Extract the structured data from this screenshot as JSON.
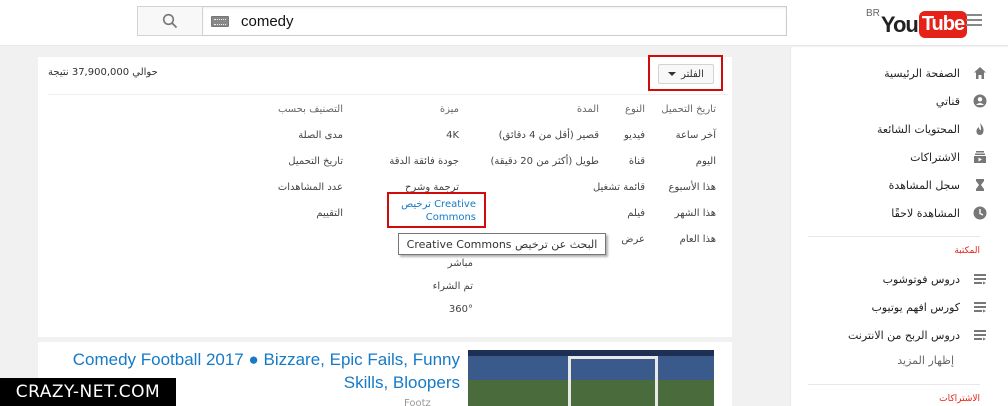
{
  "masthead": {
    "search_query": "comedy",
    "logo_region": "BR",
    "logo_you": "You",
    "logo_tube": "Tube"
  },
  "results": {
    "count_text": "حوالي 37,900,000 نتيجة",
    "filter_label": "الفلتر"
  },
  "filters": {
    "upload": {
      "head": "تاريخ التحميل",
      "items": [
        "آخر ساعة",
        "اليوم",
        "هذا الأسبوع",
        "هذا الشهر",
        "هذا العام"
      ]
    },
    "type": {
      "head": "النوع",
      "items": [
        "فيديو",
        "قناة",
        "قائمة تشغيل",
        "فيلم",
        "عرض"
      ]
    },
    "duration": {
      "head": "المدة",
      "items": [
        "قصير (أقل من 4 دقائق)",
        "طويل (أكثر من 20 دقيقة)"
      ]
    },
    "features": {
      "head": "ميزة",
      "items": [
        "4K",
        "جودة فائقة الدقة",
        "ترجمة وشرح"
      ],
      "cc_label": "ترخيص Creative Commons",
      "extra": [
        "مباشر",
        "تم الشراء",
        "360°"
      ]
    },
    "sort": {
      "head": "التصنيف بحسب",
      "items": [
        "مدى الصلة",
        "تاريخ التحميل",
        "عدد المشاهدات",
        "التقييم"
      ]
    }
  },
  "tooltip": "البحث عن ترخيص Creative Commons",
  "video": {
    "title": "Comedy Football 2017 ● Bizzare, Epic Fails, Funny Skills, Bloopers",
    "channel": "Footz"
  },
  "watermark": "CRAZY-NET.COM",
  "sidebar": {
    "nav": [
      {
        "label": "الصفحة الرئيسية",
        "icon": "home-icon"
      },
      {
        "label": "قناتي",
        "icon": "account-icon"
      },
      {
        "label": "المحتويات الشائعة",
        "icon": "trending-icon"
      },
      {
        "label": "الاشتراكات",
        "icon": "subscriptions-icon"
      },
      {
        "label": "سجل المشاهدة",
        "icon": "history-icon"
      },
      {
        "label": "المشاهدة لاحقًا",
        "icon": "clock-icon"
      }
    ],
    "library_head": "المكتبة",
    "library": [
      {
        "label": "دروس فوتوشوب",
        "icon": "playlist-icon"
      },
      {
        "label": "كورس افهم يوتيوب",
        "icon": "playlist-icon"
      },
      {
        "label": "دروس الربح من الانترنت",
        "icon": "playlist-icon"
      }
    ],
    "show_more": "إظهار المزيد",
    "subs_head": "الاشتراكات"
  },
  "colors": {
    "accent": "#e62117",
    "link": "#167ac6",
    "highlight_box": "#d10a0a"
  }
}
